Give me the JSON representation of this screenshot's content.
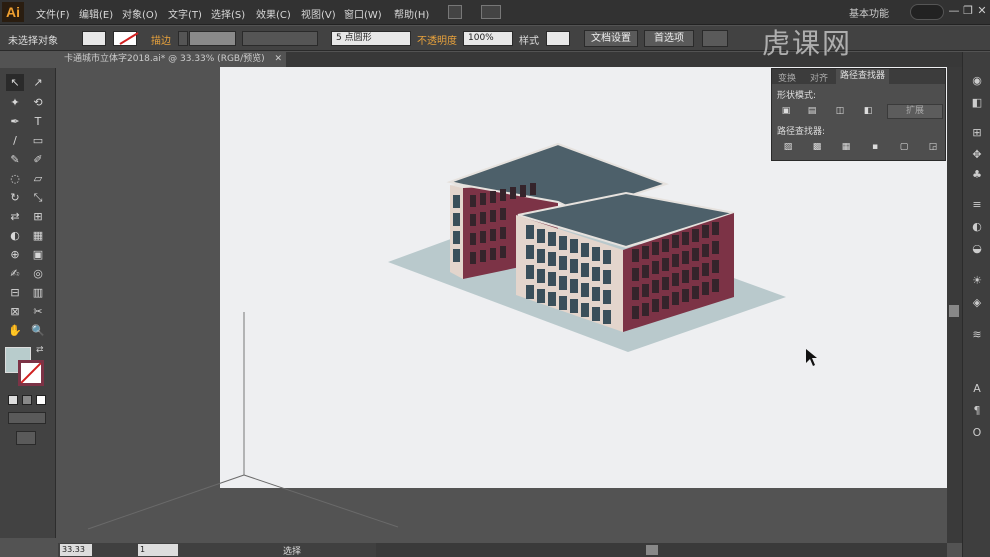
{
  "app": {
    "logo": "Ai",
    "workspace": "基本功能",
    "title_controls": [
      "—",
      "❐",
      "✕"
    ]
  },
  "menu": [
    "文件(F)",
    "编辑(E)",
    "对象(O)",
    "文字(T)",
    "选择(S)",
    "效果(C)",
    "视图(V)",
    "窗口(W)",
    "帮助(H)"
  ],
  "control_bar": {
    "selection": "未选择对象",
    "stroke_label": "描边",
    "brush_value": "5 点圆形",
    "opacity_label": "不透明度",
    "opacity_value": "100%",
    "style_label": "样式",
    "doc_setup": "文档设置",
    "prefs": "首选项"
  },
  "document_tab": {
    "name": "卡通城市立体字2018.ai* @ 33.33% (RGB/预览)",
    "close": "✕"
  },
  "tools": [
    "↖",
    "↗",
    "✦",
    "⟲",
    "✒",
    "T",
    "/",
    "▭",
    "✎",
    "✐",
    "◌",
    "▱",
    "↻",
    "⤡",
    "⇄",
    "⊞",
    "◐",
    "▦",
    "⊕",
    "▣",
    "✍",
    "◎",
    "⊟",
    "▥",
    "⊠",
    "✂",
    "✋",
    "🔍"
  ],
  "status": {
    "zoom": "33.33",
    "page": "1",
    "mode": "选择"
  },
  "pathfinder": {
    "tabs": [
      "变换",
      "对齐",
      "路径查找器"
    ],
    "shape_modes_label": "形状模式:",
    "expand_label": "扩展",
    "pathfinders_label": "路径查找器:",
    "shape_icons": [
      "▣",
      "▤",
      "◫",
      "◧"
    ],
    "pf_icons": [
      "▨",
      "▩",
      "▦",
      "▪",
      "▢",
      "◲"
    ]
  },
  "dock_icons": [
    "◉",
    "◧",
    "⊞",
    "✥",
    "♣",
    "≡",
    "◐",
    "◒",
    "☀",
    "◈",
    "≋",
    "A",
    "¶",
    "O"
  ],
  "watermark": "虎课网",
  "colors": {
    "roof": "#4d606a",
    "roof_edge": "#e6e2de",
    "wall_red": "#7c3346",
    "wall_light": "#e3d5cc",
    "window": "#3a4f5a",
    "shadow": "#b8c8ca",
    "artboard": "#eeeff1"
  }
}
